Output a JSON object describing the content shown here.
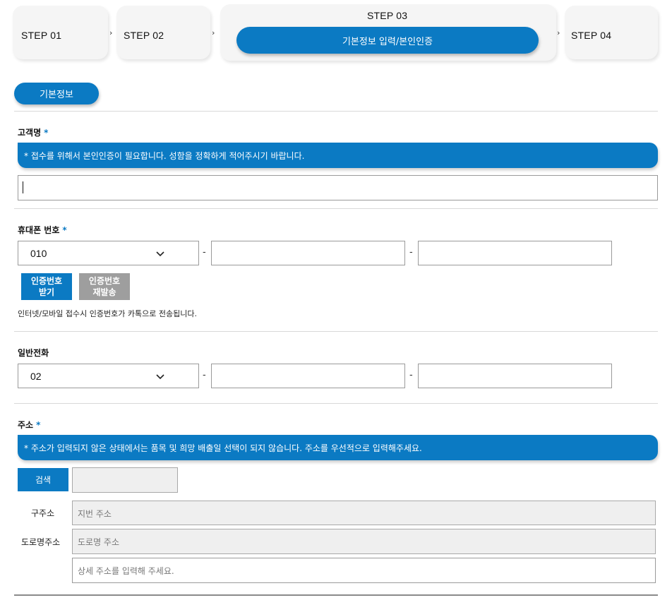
{
  "steps": {
    "step1": "STEP 01",
    "step2": "STEP 02",
    "step3": "STEP 03",
    "step3_pill": "기본정보 입력/본인인증",
    "step4": "STEP 04",
    "chevron": "›"
  },
  "section_title": "기본정보",
  "customer_name": {
    "label": "고객명",
    "required": "*",
    "notice": "* 접수를 위해서 본인인증이 필요합니다. 성함을 정확하게 적어주시기 바랍니다.",
    "value": ""
  },
  "mobile": {
    "label": "휴대폰 번호",
    "required": "*",
    "prefix_selected": "010",
    "separator": "-",
    "middle": "",
    "last": "",
    "btn_request_line1": "인증번호",
    "btn_request_line2": "받기",
    "btn_resend_line1": "인증번호",
    "btn_resend_line2": "재발송",
    "hint": "인터넷/모바일 접수시 인증번호가 카톡으로 전송됩니다."
  },
  "phone": {
    "label": "일반전화",
    "prefix_selected": "02",
    "separator": "-",
    "middle": "",
    "last": ""
  },
  "address": {
    "label": "주소",
    "required": "*",
    "notice": "* 주소가 입력되지 않은 상태에서는 품목 및 희망 배출일 선택이 되지 않습니다. 주소를 우선적으로 입력해주세요.",
    "search_button": "검색",
    "postal_code": "",
    "old_label": "구주소",
    "old_placeholder": "지번 주소",
    "road_label": "도로명주소",
    "road_placeholder": "도로명 주소",
    "detail_placeholder": "상세 주소를 입력해 주세요."
  },
  "colors": {
    "accent": "#0b7ac3",
    "disabled_button": "#9e9e9e",
    "step_card": "#f5f5f5"
  }
}
